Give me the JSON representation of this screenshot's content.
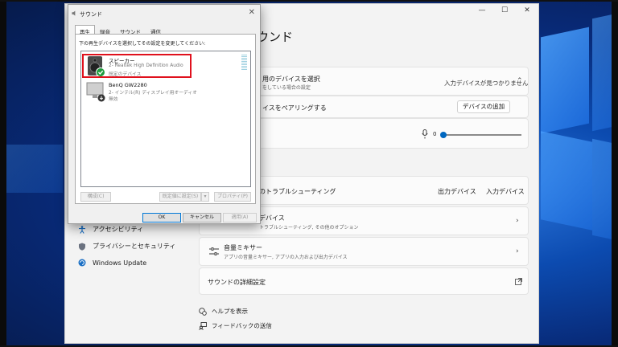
{
  "settings": {
    "page_title": "ウンド",
    "controls": {
      "minimize": "—",
      "maximize": "☐",
      "close": "✕"
    },
    "input_card": {
      "title": "用のデバイスを選択",
      "subtitle": "をしている場合の設定",
      "status": "入力デバイスが見つかりません"
    },
    "pair_card": {
      "title": "イスをペアリングする",
      "button": "デバイスの追加"
    },
    "volume_card": {
      "value": "0"
    },
    "troubleshoot_card": {
      "title": "のトラブルシューティング",
      "output": "出力デバイス",
      "input": "入力デバイス"
    },
    "all_devices_card": {
      "title": "デバイス",
      "subtitle": "トラブルシューティング, その他のオプション"
    },
    "mixer_card": {
      "title": "音量ミキサー",
      "subtitle": "アプリの音量ミキサー, アプリの入力および出力デバイス"
    },
    "advanced_card": {
      "title": "サウンドの詳細設定"
    },
    "help": "ヘルプを表示",
    "feedback": "フィードバックの送信"
  },
  "nav": [
    {
      "label": "アクセシビリティ"
    },
    {
      "label": "プライバシーとセキュリティ"
    },
    {
      "label": "Windows Update"
    }
  ],
  "dialog": {
    "title": "サウンド",
    "tabs": [
      "再生",
      "録音",
      "サウンド",
      "通信"
    ],
    "instruction": "下の再生デバイスを選択してその設定を変更してください:",
    "devices": [
      {
        "name": "スピーカー",
        "line1": "2- Realtek High Definition Audio",
        "line2": "既定のデバイス"
      },
      {
        "name": "BenQ GW2280",
        "line1": "2- インテル(R) ディスプレイ用オーディオ",
        "line2": "無効"
      }
    ],
    "buttons": {
      "configure": "構成(C)",
      "set_default": "既定値に設定(S)",
      "properties": "プロパティ(P)",
      "ok": "OK",
      "cancel": "キャンセル",
      "apply": "適用(A)"
    }
  }
}
